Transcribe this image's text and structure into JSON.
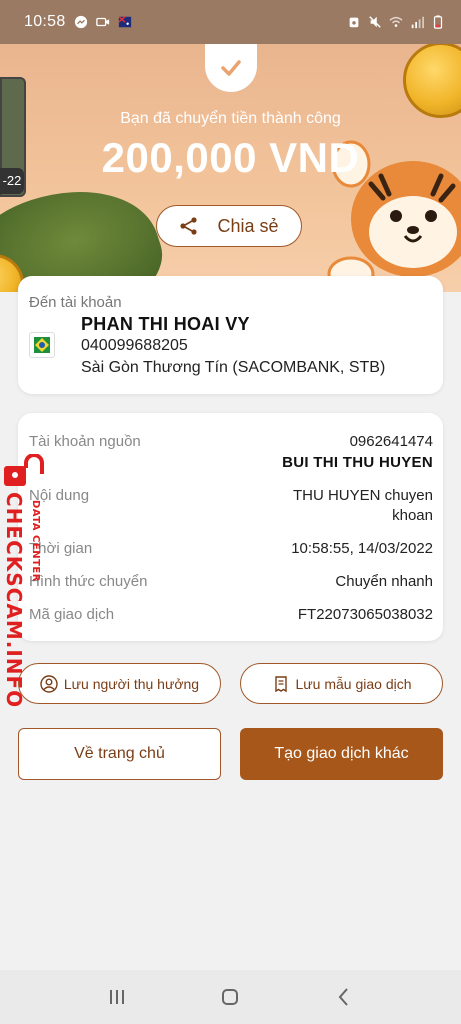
{
  "status_bar": {
    "time": "10:58",
    "icons": [
      "messenger-icon",
      "video-icon",
      "flag-icon",
      "alarm-icon",
      "mute-icon",
      "wifi-icon",
      "signal-icon",
      "battery-icon"
    ]
  },
  "banner": {
    "success_text": "Bạn đã chuyển tiền thành công",
    "amount": "200,000 VND",
    "share_label": "Chia sẻ",
    "side_thumb_label": "-22"
  },
  "destination": {
    "label": "Đến tài khoản",
    "name": "PHAN THI HOAI VY",
    "account": "040099688205",
    "bank": "Sài Gòn Thương Tín (SACOMBANK, STB)"
  },
  "details": {
    "rows": [
      {
        "label": "Tài khoản nguồn",
        "value": "0962641474",
        "value2": "BUI THI THU HUYEN"
      },
      {
        "label": "Nội dung",
        "value": "THU HUYEN chuyen",
        "value2": "khoan"
      },
      {
        "label": "Thời gian",
        "value": "10:58:55, 14/03/2022"
      },
      {
        "label": "Hình thức chuyển",
        "value": "Chuyển nhanh"
      },
      {
        "label": "Mã giao dịch",
        "value": "FT22073065038032"
      }
    ]
  },
  "actions": {
    "save_beneficiary": "Lưu người thụ hưởng",
    "save_template": "Lưu mẫu giao dịch",
    "home": "Về trang chủ",
    "new_transaction": "Tạo giao dịch khác"
  },
  "watermark": {
    "text": "CHECKSCAM.INFO",
    "sub": "DATA CENTER"
  },
  "colors": {
    "accent": "#a65719",
    "accent_border": "#a0582a",
    "status_bar": "#9b7a63",
    "watermark": "#e02020"
  }
}
